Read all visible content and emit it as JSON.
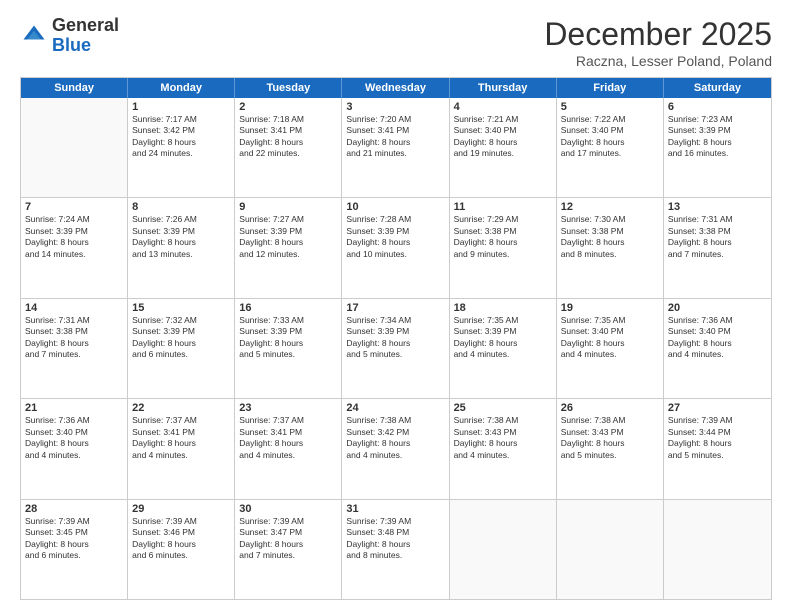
{
  "header": {
    "logo_general": "General",
    "logo_blue": "Blue",
    "month_title": "December 2025",
    "location": "Raczna, Lesser Poland, Poland"
  },
  "weekdays": [
    "Sunday",
    "Monday",
    "Tuesday",
    "Wednesday",
    "Thursday",
    "Friday",
    "Saturday"
  ],
  "rows": [
    [
      {
        "day": "",
        "lines": []
      },
      {
        "day": "1",
        "lines": [
          "Sunrise: 7:17 AM",
          "Sunset: 3:42 PM",
          "Daylight: 8 hours",
          "and 24 minutes."
        ]
      },
      {
        "day": "2",
        "lines": [
          "Sunrise: 7:18 AM",
          "Sunset: 3:41 PM",
          "Daylight: 8 hours",
          "and 22 minutes."
        ]
      },
      {
        "day": "3",
        "lines": [
          "Sunrise: 7:20 AM",
          "Sunset: 3:41 PM",
          "Daylight: 8 hours",
          "and 21 minutes."
        ]
      },
      {
        "day": "4",
        "lines": [
          "Sunrise: 7:21 AM",
          "Sunset: 3:40 PM",
          "Daylight: 8 hours",
          "and 19 minutes."
        ]
      },
      {
        "day": "5",
        "lines": [
          "Sunrise: 7:22 AM",
          "Sunset: 3:40 PM",
          "Daylight: 8 hours",
          "and 17 minutes."
        ]
      },
      {
        "day": "6",
        "lines": [
          "Sunrise: 7:23 AM",
          "Sunset: 3:39 PM",
          "Daylight: 8 hours",
          "and 16 minutes."
        ]
      }
    ],
    [
      {
        "day": "7",
        "lines": [
          "Sunrise: 7:24 AM",
          "Sunset: 3:39 PM",
          "Daylight: 8 hours",
          "and 14 minutes."
        ]
      },
      {
        "day": "8",
        "lines": [
          "Sunrise: 7:26 AM",
          "Sunset: 3:39 PM",
          "Daylight: 8 hours",
          "and 13 minutes."
        ]
      },
      {
        "day": "9",
        "lines": [
          "Sunrise: 7:27 AM",
          "Sunset: 3:39 PM",
          "Daylight: 8 hours",
          "and 12 minutes."
        ]
      },
      {
        "day": "10",
        "lines": [
          "Sunrise: 7:28 AM",
          "Sunset: 3:39 PM",
          "Daylight: 8 hours",
          "and 10 minutes."
        ]
      },
      {
        "day": "11",
        "lines": [
          "Sunrise: 7:29 AM",
          "Sunset: 3:38 PM",
          "Daylight: 8 hours",
          "and 9 minutes."
        ]
      },
      {
        "day": "12",
        "lines": [
          "Sunrise: 7:30 AM",
          "Sunset: 3:38 PM",
          "Daylight: 8 hours",
          "and 8 minutes."
        ]
      },
      {
        "day": "13",
        "lines": [
          "Sunrise: 7:31 AM",
          "Sunset: 3:38 PM",
          "Daylight: 8 hours",
          "and 7 minutes."
        ]
      }
    ],
    [
      {
        "day": "14",
        "lines": [
          "Sunrise: 7:31 AM",
          "Sunset: 3:38 PM",
          "Daylight: 8 hours",
          "and 7 minutes."
        ]
      },
      {
        "day": "15",
        "lines": [
          "Sunrise: 7:32 AM",
          "Sunset: 3:39 PM",
          "Daylight: 8 hours",
          "and 6 minutes."
        ]
      },
      {
        "day": "16",
        "lines": [
          "Sunrise: 7:33 AM",
          "Sunset: 3:39 PM",
          "Daylight: 8 hours",
          "and 5 minutes."
        ]
      },
      {
        "day": "17",
        "lines": [
          "Sunrise: 7:34 AM",
          "Sunset: 3:39 PM",
          "Daylight: 8 hours",
          "and 5 minutes."
        ]
      },
      {
        "day": "18",
        "lines": [
          "Sunrise: 7:35 AM",
          "Sunset: 3:39 PM",
          "Daylight: 8 hours",
          "and 4 minutes."
        ]
      },
      {
        "day": "19",
        "lines": [
          "Sunrise: 7:35 AM",
          "Sunset: 3:40 PM",
          "Daylight: 8 hours",
          "and 4 minutes."
        ]
      },
      {
        "day": "20",
        "lines": [
          "Sunrise: 7:36 AM",
          "Sunset: 3:40 PM",
          "Daylight: 8 hours",
          "and 4 minutes."
        ]
      }
    ],
    [
      {
        "day": "21",
        "lines": [
          "Sunrise: 7:36 AM",
          "Sunset: 3:40 PM",
          "Daylight: 8 hours",
          "and 4 minutes."
        ]
      },
      {
        "day": "22",
        "lines": [
          "Sunrise: 7:37 AM",
          "Sunset: 3:41 PM",
          "Daylight: 8 hours",
          "and 4 minutes."
        ]
      },
      {
        "day": "23",
        "lines": [
          "Sunrise: 7:37 AM",
          "Sunset: 3:41 PM",
          "Daylight: 8 hours",
          "and 4 minutes."
        ]
      },
      {
        "day": "24",
        "lines": [
          "Sunrise: 7:38 AM",
          "Sunset: 3:42 PM",
          "Daylight: 8 hours",
          "and 4 minutes."
        ]
      },
      {
        "day": "25",
        "lines": [
          "Sunrise: 7:38 AM",
          "Sunset: 3:43 PM",
          "Daylight: 8 hours",
          "and 4 minutes."
        ]
      },
      {
        "day": "26",
        "lines": [
          "Sunrise: 7:38 AM",
          "Sunset: 3:43 PM",
          "Daylight: 8 hours",
          "and 5 minutes."
        ]
      },
      {
        "day": "27",
        "lines": [
          "Sunrise: 7:39 AM",
          "Sunset: 3:44 PM",
          "Daylight: 8 hours",
          "and 5 minutes."
        ]
      }
    ],
    [
      {
        "day": "28",
        "lines": [
          "Sunrise: 7:39 AM",
          "Sunset: 3:45 PM",
          "Daylight: 8 hours",
          "and 6 minutes."
        ]
      },
      {
        "day": "29",
        "lines": [
          "Sunrise: 7:39 AM",
          "Sunset: 3:46 PM",
          "Daylight: 8 hours",
          "and 6 minutes."
        ]
      },
      {
        "day": "30",
        "lines": [
          "Sunrise: 7:39 AM",
          "Sunset: 3:47 PM",
          "Daylight: 8 hours",
          "and 7 minutes."
        ]
      },
      {
        "day": "31",
        "lines": [
          "Sunrise: 7:39 AM",
          "Sunset: 3:48 PM",
          "Daylight: 8 hours",
          "and 8 minutes."
        ]
      },
      {
        "day": "",
        "lines": []
      },
      {
        "day": "",
        "lines": []
      },
      {
        "day": "",
        "lines": []
      }
    ]
  ]
}
